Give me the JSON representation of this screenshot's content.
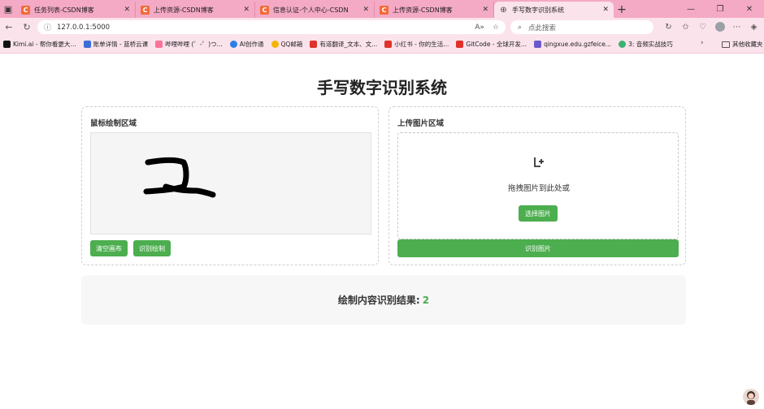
{
  "browser": {
    "tabs": [
      {
        "label": "任务列表-CSDN博客",
        "active": false
      },
      {
        "label": "上传资源-CSDN博客",
        "active": false
      },
      {
        "label": "信息认证-个人中心-CSDN",
        "active": false
      },
      {
        "label": "上传资源-CSDN博客",
        "active": false
      },
      {
        "label": "手写数字识别系统",
        "active": true
      }
    ],
    "url": "127.0.0.1:5000",
    "search_placeholder": "点此搜索",
    "bookmarks": [
      {
        "label": "Kimi.ai - 帮你看更大...",
        "color": "#111111"
      },
      {
        "label": "账单详情 - 蓝桥云课",
        "color": "#3b6fd8"
      },
      {
        "label": "哔哩哔哩 (゜-゜)つ...",
        "color": "#fb7299"
      },
      {
        "label": "AI创作通",
        "color": "#2b7de9"
      },
      {
        "label": "QQ邮箱",
        "color": "#f5b400"
      },
      {
        "label": "有道翻译_文本、文...",
        "color": "#e0312c"
      },
      {
        "label": "小红书 - 你的生活...",
        "color": "#e0312c"
      },
      {
        "label": "GitCode - 全球开发...",
        "color": "#e0312c"
      },
      {
        "label": "qingxue.edu.gzfeice...",
        "color": "#6a5acd"
      },
      {
        "label": "3: 音频实战技巧",
        "color": "#3cb371"
      }
    ],
    "bookmarks_folder": "其他收藏夹"
  },
  "page": {
    "title": "手写数字识别系统",
    "draw_panel": {
      "title": "鼠标绘制区域",
      "clear_label": "清空画布",
      "recognize_label": "识别绘制"
    },
    "upload_panel": {
      "title": "上传图片区域",
      "upload_icon": "add-image-icon",
      "drop_text": "拖拽图片到此处或",
      "choose_label": "选择图片",
      "recognize_label": "识别图片"
    },
    "result": {
      "label": "绘制内容识别结果:",
      "value": "2"
    }
  },
  "colors": {
    "accent": "#4cae4f",
    "tabbar": "#f4a9c4",
    "chrome": "#fbe3ec"
  }
}
